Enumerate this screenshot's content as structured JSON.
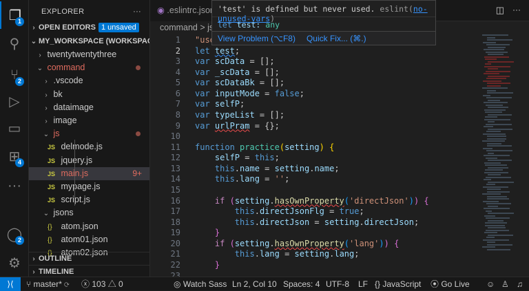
{
  "activity": [
    {
      "icon": "files-icon",
      "badge": "1",
      "active": true
    },
    {
      "icon": "search-icon"
    },
    {
      "icon": "source-control-icon",
      "badge": "2"
    },
    {
      "icon": "run-debug-icon"
    },
    {
      "icon": "remote-explorer-icon"
    },
    {
      "icon": "extensions-icon",
      "badge": "4"
    },
    {
      "icon": "more-icon"
    },
    {
      "icon": "account-icon",
      "badge": "2"
    },
    {
      "icon": "settings-gear-icon"
    }
  ],
  "explorer": {
    "title": "EXPLORER",
    "more": "···",
    "open_editors": "OPEN EDITORS",
    "unsaved": "1 unsaved",
    "workspace": "MY_WORKSPACE (WORKSPACE)",
    "outline": "OUTLINE",
    "timeline": "TIMELINE",
    "tree": [
      {
        "label": "twentytwentythree",
        "type": "folder",
        "open": false,
        "depth": 1
      },
      {
        "label": "command",
        "type": "folder",
        "open": true,
        "depth": 1,
        "modified": true
      },
      {
        "label": ".vscode",
        "type": "folder",
        "open": false,
        "depth": 2
      },
      {
        "label": "bk",
        "type": "folder",
        "open": false,
        "depth": 2
      },
      {
        "label": "dataimage",
        "type": "folder",
        "open": false,
        "depth": 2
      },
      {
        "label": "image",
        "type": "folder",
        "open": false,
        "depth": 2
      },
      {
        "label": "js",
        "type": "folder",
        "open": true,
        "depth": 2,
        "modified": true
      },
      {
        "label": "delmode.js",
        "type": "js",
        "depth": 3
      },
      {
        "label": "jquery.js",
        "type": "js",
        "depth": 3
      },
      {
        "label": "main.js",
        "type": "js",
        "depth": 3,
        "selected": true,
        "problems": "9+"
      },
      {
        "label": "mypage.js",
        "type": "js",
        "depth": 3
      },
      {
        "label": "script.js",
        "type": "js",
        "depth": 3
      },
      {
        "label": "jsons",
        "type": "folder",
        "open": true,
        "depth": 2
      },
      {
        "label": "atom.json",
        "type": "json",
        "depth": 3
      },
      {
        "label": "atom01.json",
        "type": "json",
        "depth": 3
      },
      {
        "label": "atom02.json",
        "type": "json",
        "depth": 3
      }
    ]
  },
  "tabs": [
    {
      "label": ".eslintrc.json"
    }
  ],
  "breadcrumb": "command > js",
  "hover": {
    "message": "'test' is defined but never used.",
    "source": "eslint(",
    "rule": "no-unused-vars",
    "close": ")",
    "sig_kw": "let",
    "sig_name": "test:",
    "sig_type": "any",
    "view_problem": "View Problem (⌥F8)",
    "quick_fix": "Quick Fix... (⌘.)"
  },
  "code": [
    [
      [
        "\"use strict\";",
        "s"
      ]
    ],
    [
      [
        "let ",
        "k"
      ],
      [
        "test",
        "v sqb"
      ],
      [
        ";",
        ""
      ]
    ],
    [
      [
        "var ",
        "k"
      ],
      [
        "scData",
        "v"
      ],
      [
        " = [];",
        ""
      ]
    ],
    [
      [
        "var ",
        "k"
      ],
      [
        "_scData",
        "v"
      ],
      [
        " = [];",
        ""
      ]
    ],
    [
      [
        "var ",
        "k"
      ],
      [
        "scDataBk",
        "v"
      ],
      [
        " = [];",
        ""
      ]
    ],
    [
      [
        "var ",
        "k"
      ],
      [
        "inputMode",
        "v"
      ],
      [
        " = ",
        ""
      ],
      [
        "false",
        "k"
      ],
      [
        ";",
        ""
      ]
    ],
    [
      [
        "var ",
        "k"
      ],
      [
        "selfP",
        "v"
      ],
      [
        ";",
        ""
      ]
    ],
    [
      [
        "var ",
        "k"
      ],
      [
        "typeList",
        "v"
      ],
      [
        " = [];",
        ""
      ]
    ],
    [
      [
        "var ",
        "k"
      ],
      [
        "urlPram",
        "v sq"
      ],
      [
        " = {};",
        ""
      ]
    ],
    [],
    [
      [
        "function ",
        "k"
      ],
      [
        "practice",
        "f"
      ],
      [
        "(",
        "y"
      ],
      [
        "setting",
        "v"
      ],
      [
        ") ",
        "y"
      ],
      [
        "{",
        "y"
      ]
    ],
    [
      [
        "    selfP",
        "v"
      ],
      [
        " = ",
        ""
      ],
      [
        "this",
        "k"
      ],
      [
        ";",
        ""
      ]
    ],
    [
      [
        "    this",
        "k"
      ],
      [
        ".",
        ""
      ],
      [
        "name",
        "v"
      ],
      [
        " = ",
        ""
      ],
      [
        "setting",
        "v"
      ],
      [
        ".",
        ""
      ],
      [
        "name",
        "v"
      ],
      [
        ";",
        ""
      ]
    ],
    [
      [
        "    this",
        "k"
      ],
      [
        ".",
        ""
      ],
      [
        "lang",
        "v"
      ],
      [
        " = ",
        ""
      ],
      [
        "''",
        "s"
      ],
      [
        ";",
        ""
      ]
    ],
    [],
    [
      [
        "    if ",
        "c"
      ],
      [
        "(",
        "p"
      ],
      [
        "setting",
        "v"
      ],
      [
        ".",
        ""
      ],
      [
        "hasOwnProperty",
        "m sq"
      ],
      [
        "(",
        "b"
      ],
      [
        "'directJson'",
        "s"
      ],
      [
        ")",
        "b"
      ],
      [
        ")",
        "p"
      ],
      [
        " {",
        "p"
      ]
    ],
    [
      [
        "        this",
        "k"
      ],
      [
        ".",
        ""
      ],
      [
        "directJsonFlg",
        "v"
      ],
      [
        " = ",
        ""
      ],
      [
        "true",
        "k"
      ],
      [
        ";",
        ""
      ]
    ],
    [
      [
        "        this",
        "k"
      ],
      [
        ".",
        ""
      ],
      [
        "directJson",
        "v"
      ],
      [
        " = ",
        ""
      ],
      [
        "setting",
        "v"
      ],
      [
        ".",
        ""
      ],
      [
        "directJson",
        "v"
      ],
      [
        ";",
        ""
      ]
    ],
    [
      [
        "    }",
        "p"
      ]
    ],
    [
      [
        "    if ",
        "c"
      ],
      [
        "(",
        "p"
      ],
      [
        "setting",
        "v"
      ],
      [
        ".",
        ""
      ],
      [
        "hasOwnProperty",
        "m sq"
      ],
      [
        "(",
        "b"
      ],
      [
        "'lang'",
        "s"
      ],
      [
        ")",
        "b"
      ],
      [
        ")",
        "p"
      ],
      [
        " {",
        "p"
      ]
    ],
    [
      [
        "        this",
        "k"
      ],
      [
        ".",
        ""
      ],
      [
        "lang",
        "v"
      ],
      [
        " = ",
        ""
      ],
      [
        "setting",
        "v"
      ],
      [
        ".",
        ""
      ],
      [
        "lang",
        "v"
      ],
      [
        ";",
        ""
      ]
    ],
    [
      [
        "    }",
        "p"
      ]
    ],
    []
  ],
  "current_line": 2,
  "status": {
    "branch": "master*",
    "errors": "103",
    "warnings": "0",
    "watch": "Watch Sass",
    "position": "Ln 2, Col 10",
    "spaces": "Spaces: 4",
    "encoding": "UTF-8",
    "eol": "LF",
    "language": "JavaScript",
    "golive": "Go Live"
  },
  "colors": {
    "accent": "#0078d4",
    "modified": "#e06c5f",
    "error_squiggle": "#f14c4c"
  }
}
